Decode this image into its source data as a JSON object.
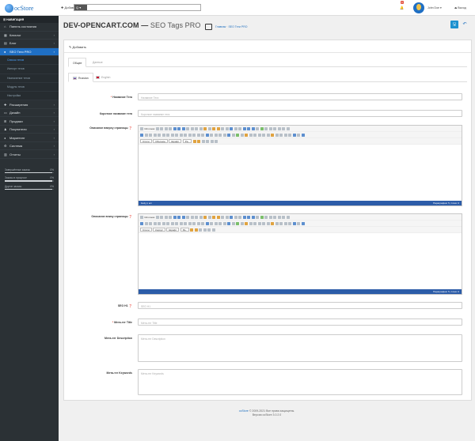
{
  "header": {
    "logo_text": "ocStore",
    "add_label": "✚ Добавить",
    "search_label": "Q ▾",
    "notifications_count": "9",
    "user_name": "John Doe ▾",
    "logout_label": "⏏ Выход"
  },
  "sidebar": {
    "heading": "☰ НАВИГАЦИЯ",
    "items": [
      {
        "icon": "⌂",
        "label": "Панель состояния"
      },
      {
        "icon": "▦",
        "label": "Каталог"
      },
      {
        "icon": "▤",
        "label": "Блог"
      },
      {
        "icon": "●",
        "label": "SEO Теги PRO"
      }
    ],
    "subitems": [
      "Список тегов",
      "Импорт тегов",
      "Назначение тегов",
      "Модуль тегов",
      "Настройки"
    ],
    "items2": [
      {
        "icon": "✚",
        "label": "Расширения"
      },
      {
        "icon": "▭",
        "label": "Дизайн"
      },
      {
        "icon": "⊞",
        "label": "Продажи"
      },
      {
        "icon": "♟",
        "label": "Покупатели"
      },
      {
        "icon": "◂",
        "label": "Маркетинг"
      },
      {
        "icon": "⚙",
        "label": "Система"
      },
      {
        "icon": "▥",
        "label": "Отчеты"
      }
    ],
    "stats": [
      {
        "label": "Завершённые заказы",
        "value": "0%",
        "fill": 0.97
      },
      {
        "label": "Заказы в процессе",
        "value": "0%",
        "fill": 0.97
      },
      {
        "label": "Другие заказы",
        "value": "0%",
        "fill": 0.97
      }
    ]
  },
  "page": {
    "title_store": "DEV-OPENCART.COM —",
    "title_module": " SEO Tags PRO",
    "breadcrumb_home": "Главная",
    "breadcrumb_sep": " · ",
    "breadcrumb_current": "SEO Теги PRO",
    "save_icon": "🖫",
    "back_icon": "↶"
  },
  "panel": {
    "heading": "✎ Добавить",
    "tab_general": "Общее",
    "tab_data": "Данные",
    "lang_ru": "Russian",
    "lang_en": "English"
  },
  "form": {
    "name_label": "Название Тега",
    "name_placeholder": "Название Тега",
    "short_label": "Короткое название тега",
    "short_placeholder": "Короткое название тега",
    "desc_top_label": "Описание вверху страницы",
    "desc_bottom_label": "Описание внизу страницы",
    "h1_label": "SEO H1",
    "h1_placeholder": "SEO H1",
    "meta_title_label": "Мета-тег Title",
    "meta_title_placeholder": "Мета-тег Title",
    "meta_desc_label": "Мета-тег Description",
    "meta_desc_placeholder": "Мета-тег Description",
    "meta_kw_label": "Мета-тег Keywords",
    "meta_kw_placeholder": "Мета-тег Keywords",
    "req_mark": "*",
    "help_mark": "❓"
  },
  "editor": {
    "source_label": "Источник",
    "style_select": "Стили",
    "format_select": "Обычное",
    "font_select": "Шрифт",
    "size_select": "Ра..",
    "font_select_2": "Корпус",
    "status_path": "body  p  em",
    "status_counts": "Параграфов: 5, Слов: 0"
  },
  "footer": {
    "brand": "ocStore",
    "copyright": " © 2009-2021 Все права защищены.",
    "version": "Версия ocStore 3.0.2.0"
  }
}
